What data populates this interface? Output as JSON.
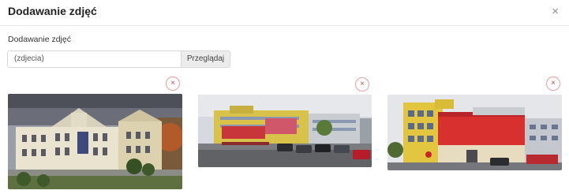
{
  "modal": {
    "title": "Dodawanie zdjęć",
    "close_glyph": "×"
  },
  "form": {
    "field_label": "Dodawanie zdjęć",
    "file_input_value": "(zdjecia)",
    "browse_label": "Przeglądaj"
  },
  "thumbnails": [
    {
      "remove_glyph": "×",
      "subject": "historic-white-building"
    },
    {
      "remove_glyph": "×",
      "subject": "school-building-with-parking"
    },
    {
      "remove_glyph": "×",
      "subject": "school-building-red-facade"
    }
  ],
  "colors": {
    "remove_border": "#e8a0a0",
    "remove_glyph": "#c54c4c",
    "header_divider": "#e6e6e6"
  }
}
